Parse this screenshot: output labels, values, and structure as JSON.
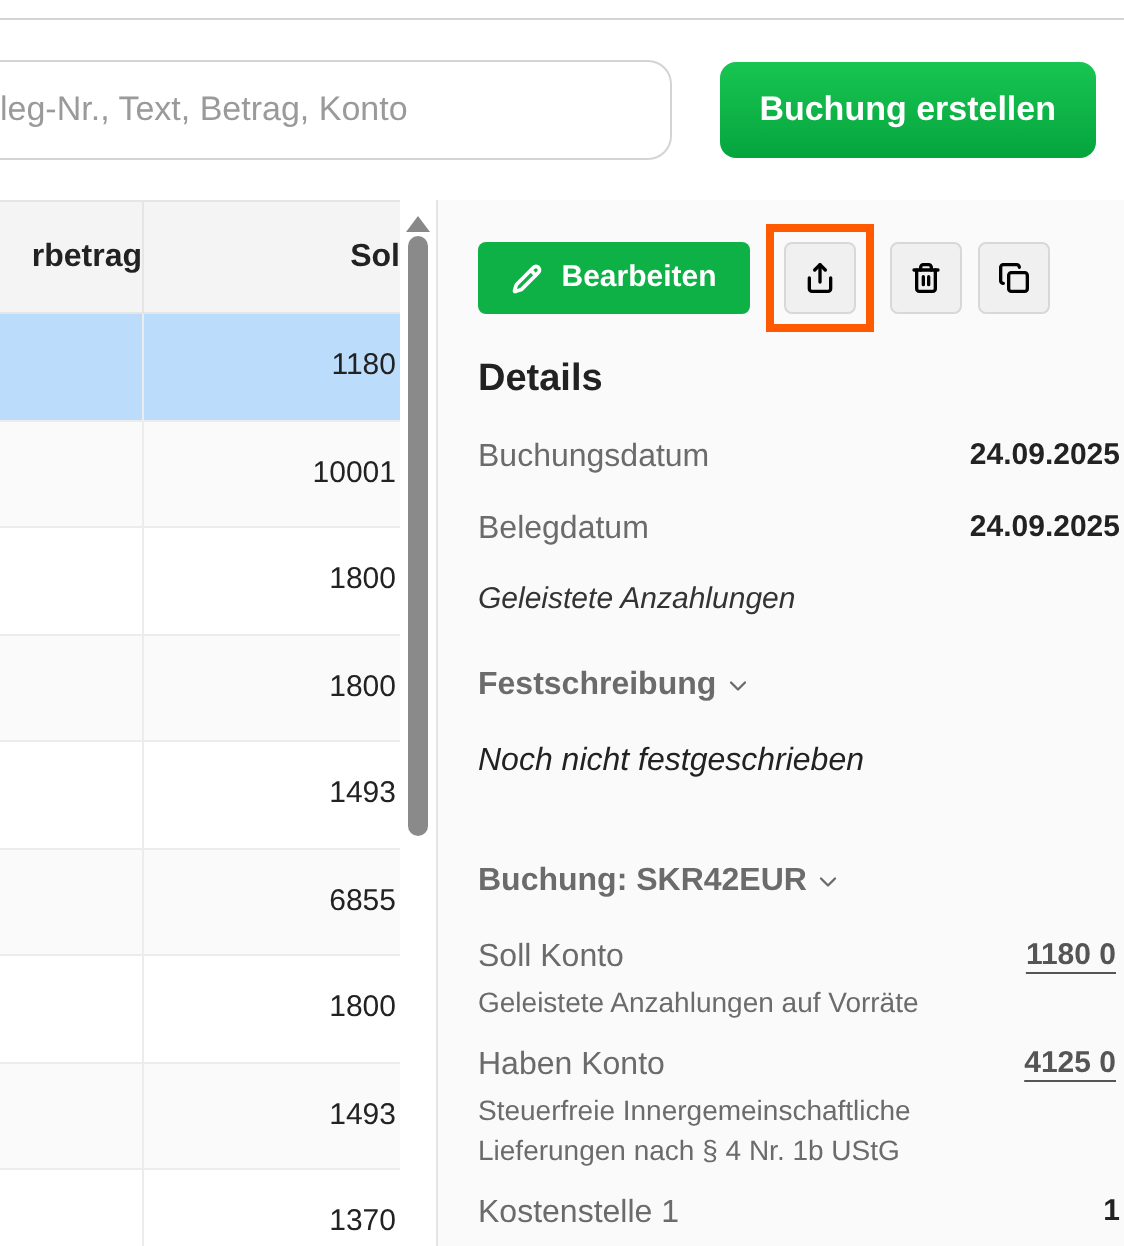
{
  "search": {
    "placeholder": "leg-Nr., Text, Betrag, Konto"
  },
  "create_button": "Buchung erstellen",
  "table": {
    "columns": [
      "rbetrag",
      "Sol"
    ],
    "rows": [
      {
        "selected": true,
        "soll": "1180"
      },
      {
        "selected": false,
        "soll": "10001"
      },
      {
        "selected": false,
        "soll": "1800"
      },
      {
        "selected": false,
        "soll": "1800"
      },
      {
        "selected": false,
        "soll": "1493"
      },
      {
        "selected": false,
        "soll": "6855"
      },
      {
        "selected": false,
        "soll": "1800"
      },
      {
        "selected": false,
        "soll": "1493"
      },
      {
        "selected": false,
        "soll": "1370"
      }
    ]
  },
  "toolbar": {
    "edit_label": "Bearbeiten",
    "actions": [
      {
        "kind": "export",
        "highlighted": true
      },
      {
        "kind": "delete",
        "highlighted": false
      },
      {
        "kind": "copy",
        "highlighted": false
      }
    ]
  },
  "details": {
    "title": "Details",
    "fields": [
      {
        "label": "Buchungsdatum",
        "value": "24.09.2025"
      },
      {
        "label": "Belegdatum",
        "value": "24.09.2025"
      }
    ],
    "note": "Geleistete Anzahlungen",
    "lock_section": {
      "title": "Festschreibung",
      "expanded": true,
      "status": "Noch nicht festgeschrieben"
    },
    "booking_section": {
      "title": "Buchung: SKR42EUR",
      "expanded": true,
      "accounts": [
        {
          "label": "Soll Konto",
          "number": "1180 0",
          "description": "Geleistete Anzahlungen auf Vorräte"
        },
        {
          "label": "Haben Konto",
          "number": "4125 0",
          "description": "Steuerfreie Innergemeinschaftliche Lieferungen nach § 4 Nr. 1b UStG"
        }
      ],
      "cost_center": {
        "label": "Kostenstelle 1",
        "value": "1"
      }
    }
  }
}
